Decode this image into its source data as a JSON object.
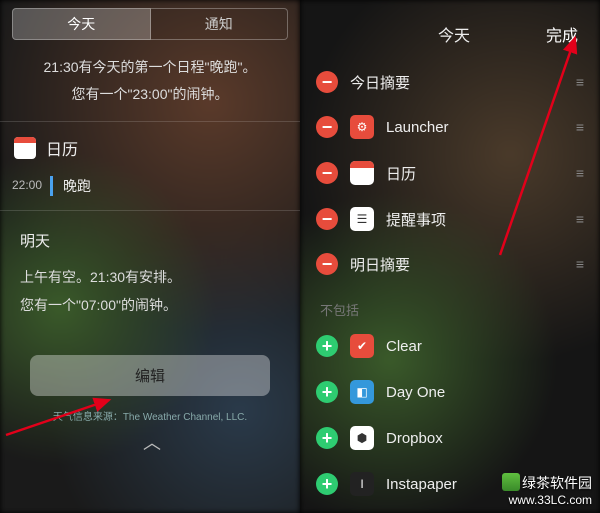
{
  "left": {
    "tabs": {
      "today": "今天",
      "notifications": "通知"
    },
    "summary": {
      "line1": "21:30有今天的第一个日程\"晚跑\"。",
      "line2": "您有一个\"23:00\"的闹钟。"
    },
    "calendar": {
      "title": "日历"
    },
    "event": {
      "time": "22:00",
      "title": "晚跑"
    },
    "tomorrow": {
      "title": "明天",
      "line1": "上午有空。21:30有安排。",
      "line2": "您有一个\"07:00\"的闹钟。"
    },
    "edit_button": "编辑",
    "weather_source": "天气信息来源：The Weather Channel, LLC."
  },
  "right": {
    "topbar": {
      "today": "今天",
      "done": "完成"
    },
    "included": [
      {
        "name": "今日摘要",
        "icon": null,
        "bg": null
      },
      {
        "name": "Launcher",
        "icon": "⚙",
        "bg": "#e74c3c"
      },
      {
        "name": "日历",
        "icon": "cal",
        "bg": "#fff"
      },
      {
        "name": "提醒事项",
        "icon": "☰",
        "bg": "#fff"
      },
      {
        "name": "明日摘要",
        "icon": null,
        "bg": null
      }
    ],
    "excluded_label": "不包括",
    "excluded": [
      {
        "name": "Clear",
        "icon": "✔",
        "bg": "#e74c3c"
      },
      {
        "name": "Day One",
        "icon": "◧",
        "bg": "#3498db"
      },
      {
        "name": "Dropbox",
        "icon": "⬢",
        "bg": "#fff"
      },
      {
        "name": "Instapaper",
        "icon": "I",
        "bg": "#222"
      }
    ]
  },
  "watermark": {
    "name": "绿茶软件园",
    "url": "www.33LC.com"
  }
}
